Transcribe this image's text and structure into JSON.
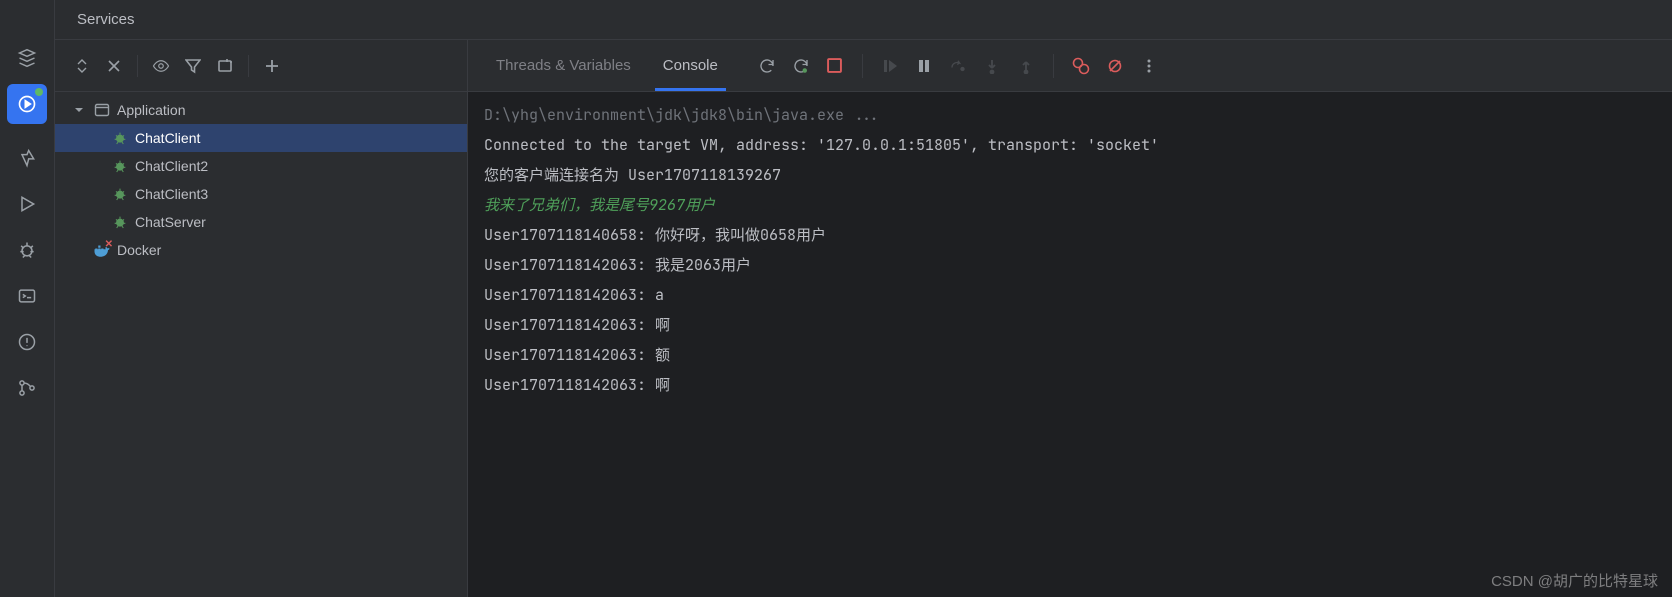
{
  "panel_title": "Services",
  "tree": {
    "root": "Application",
    "items": [
      "ChatClient",
      "ChatClient2",
      "ChatClient3",
      "ChatServer"
    ],
    "docker": "Docker"
  },
  "tabs": {
    "threads": "Threads & Variables",
    "console": "Console"
  },
  "console": {
    "cmd": "D:\\yhg\\environment\\jdk\\jdk8\\bin\\java.exe ...",
    "lines": [
      "Connected to the target VM, address: '127.0.0.1:51805', transport: 'socket'",
      "您的客户端连接名为 User1707118139267"
    ],
    "green_line": "我来了兄弟们，我是尾号9267用户",
    "msgs": [
      "User1707118140658: 你好呀，我叫做0658用户",
      "User1707118142063: 我是2063用户",
      "User1707118142063: a",
      "User1707118142063: 啊",
      "User1707118142063: 额",
      "User1707118142063: 啊"
    ]
  },
  "watermark": "CSDN @胡广的比特星球"
}
